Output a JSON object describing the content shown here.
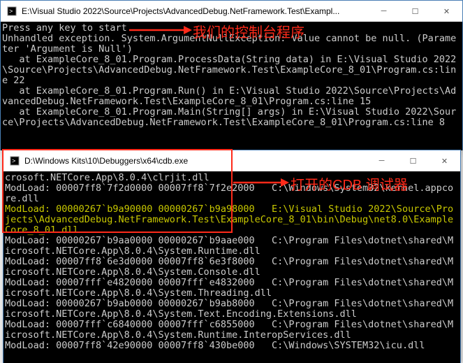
{
  "win1": {
    "title": "E:\\Visual Studio 2022\\Source\\Projects\\AdvancedDebug.NetFramework.Test\\Exampl...",
    "lines": [
      {
        "t": "Press any key to start.",
        "c": "w"
      },
      {
        "t": "Unhandled exception. System.ArgumentNullException: Value cannot be null. (Parameter 'Argument is Null')",
        "c": "w"
      },
      {
        "t": "   at ExampleCore_8_01.Program.ProcessData(String data) in E:\\Visual Studio 2022\\Source\\Projects\\AdvancedDebug.NetFramework.Test\\ExampleCore_8_01\\Program.cs:line 22",
        "c": "w"
      },
      {
        "t": "   at ExampleCore_8_01.Program.Run() in E:\\Visual Studio 2022\\Source\\Projects\\AdvancedDebug.NetFramework.Test\\ExampleCore_8_01\\Program.cs:line 15",
        "c": "w"
      },
      {
        "t": "   at ExampleCore_8_01.Program.Main(String[] args) in E:\\Visual Studio 2022\\Source\\Projects\\AdvancedDebug.NetFramework.Test\\ExampleCore_8_01\\Program.cs:line 8",
        "c": "w"
      }
    ]
  },
  "win2": {
    "title": "D:\\Windows Kits\\10\\Debuggers\\x64\\cdb.exe",
    "lines": [
      {
        "t": "crosoft.NETCore.App\\8.0.4\\clrjit.dll",
        "c": "w"
      },
      {
        "t": "ModLoad: 00007ff8`7f2d0000 00007ff8`7f2e2000   C:\\Windows\\System32\\kernel.appcore.dll",
        "c": "w"
      },
      {
        "t": "ModLoad: 00000267`b9a90000 00000267`b9a98000   E:\\Visual Studio 2022\\Source\\Projects\\AdvancedDebug.NetFramework.Test\\ExampleCore_8_01\\bin\\Debug\\net8.0\\ExampleCore_8_01.dll",
        "c": "y"
      },
      {
        "t": "ModLoad: 00000267`b9aa0000 00000267`b9aae000   C:\\Program Files\\dotnet\\shared\\Microsoft.NETCore.App\\8.0.4\\System.Runtime.dll",
        "c": "w"
      },
      {
        "t": "ModLoad: 00007ff8`6e3d0000 00007ff8`6e3f8000   C:\\Program Files\\dotnet\\shared\\Microsoft.NETCore.App\\8.0.4\\System.Console.dll",
        "c": "w"
      },
      {
        "t": "ModLoad: 00007fff`e4820000 00007fff`e4832000   C:\\Program Files\\dotnet\\shared\\Microsoft.NETCore.App\\8.0.4\\System.Threading.dll",
        "c": "w"
      },
      {
        "t": "ModLoad: 00000267`b9ab0000 00000267`b9ab8000   C:\\Program Files\\dotnet\\shared\\Microsoft.NETCore.App\\8.0.4\\System.Text.Encoding.Extensions.dll",
        "c": "w"
      },
      {
        "t": "ModLoad: 00007fff`c6840000 00007fff`c6855000   C:\\Program Files\\dotnet\\shared\\Microsoft.NETCore.App\\8.0.4\\System.Runtime.InteropServices.dll",
        "c": "w"
      },
      {
        "t": "ModLoad: 00007ff8`42e90000 00007ff8`430be000   C:\\Windows\\SYSTEM32\\icu.dll",
        "c": "w"
      }
    ]
  },
  "annot": {
    "label1": "我们的控制台程序",
    "label2": "打开的CDB 调试器"
  },
  "controls": {
    "minimize": "─",
    "maximize": "☐",
    "close": "✕"
  }
}
